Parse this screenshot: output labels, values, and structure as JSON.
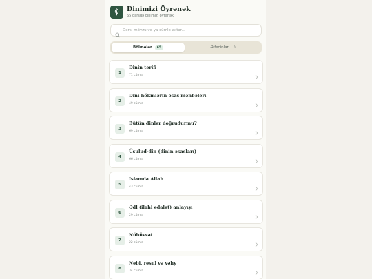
{
  "app": {
    "title": "Dinimizi Öyrənək",
    "subtitle": "65 dərsdə dinimizi öyrənək",
    "icon": "leaf-icon"
  },
  "search": {
    "placeholder": "Dərs, mövzu və ya cümlə axtar...",
    "value": ""
  },
  "tabs": [
    {
      "label": "Bölmələr",
      "count": "65",
      "active": true
    },
    {
      "label": "Əlfecinlər",
      "count": "0",
      "active": false
    }
  ],
  "lessons": [
    {
      "number": "1",
      "title": "Dinin tərifi",
      "count": "71 cümlə"
    },
    {
      "number": "2",
      "title": "Dini hökmlərin əsas mənbələri",
      "count": "49 cümlə"
    },
    {
      "number": "3",
      "title": "Bütün dinlər doğrudurmu?",
      "count": "69 cümlə"
    },
    {
      "number": "4",
      "title": "Üsuluď-din (dinin əsasları)",
      "count": "66 cümlə"
    },
    {
      "number": "5",
      "title": "İslamda Allah",
      "count": "43 cümlə"
    },
    {
      "number": "6",
      "title": "Ədl (ilahi ədalət) anlayışı",
      "count": "29 cümlə"
    },
    {
      "number": "7",
      "title": "Nübüvvət",
      "count": "22 cümlə"
    },
    {
      "number": "8",
      "title": "Nəbi, rəsul və vəhy",
      "count": "34 cümlə"
    }
  ],
  "colors": {
    "brand": "#2f5540",
    "background": "#f3f1ec",
    "tab_track": "#e8e4d7"
  }
}
